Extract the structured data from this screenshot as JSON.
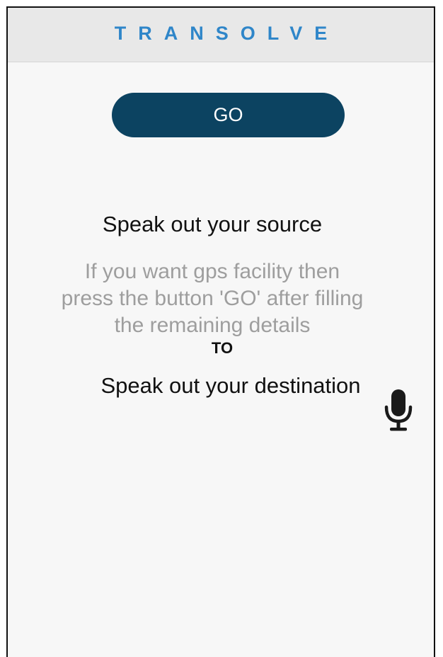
{
  "app_bar": {
    "title": "TRANSOLVE",
    "title_color": "#2f86c9",
    "background": "#e8e8e8"
  },
  "go_button": {
    "label": "GO",
    "color": "#0c4361"
  },
  "source": {
    "prompt": "Speak out your source"
  },
  "gps_hint": {
    "lines": [
      "If you want gps facility then",
      "press the button 'GO' after filling",
      "the remaining details"
    ]
  },
  "separator": {
    "label": "TO"
  },
  "destination": {
    "prompt": "Speak out your destination",
    "mic_icon": "microphone-icon"
  }
}
